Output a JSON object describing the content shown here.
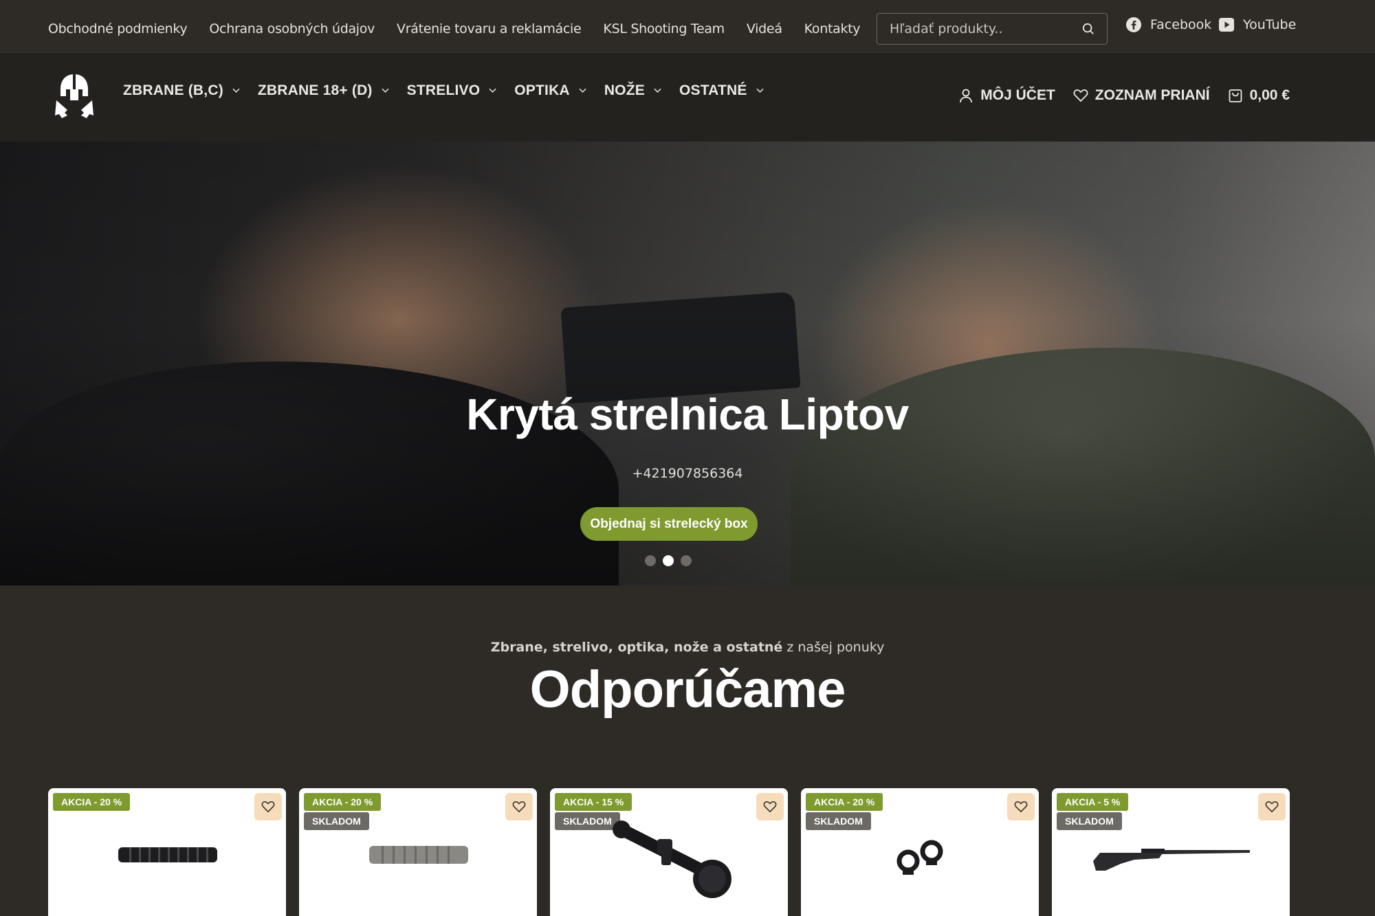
{
  "topbar": {
    "links": [
      "Obchodné podmienky",
      "Ochrana osobných údajov",
      "Vrátenie tovaru a reklamácie",
      "KSL Shooting Team",
      "Videá",
      "Kontakty"
    ],
    "search_placeholder": "Hľadať produkty..",
    "facebook": "Facebook",
    "youtube": "YouTube"
  },
  "nav": {
    "items": [
      "ZBRANE (B,C)",
      "ZBRANE 18+ (D)",
      "STRELIVO",
      "OPTIKA",
      "NOŽE",
      "OSTATNÉ"
    ],
    "account": "MÔJ ÚČET",
    "wishlist": "ZOZNAM PRIANÍ",
    "cart": "0,00 €"
  },
  "hero": {
    "title": "Krytá strelnica Liptov",
    "phone": "+421907856364",
    "cta": "Objednaj si strelecký box",
    "slides": 3,
    "active_slide": 2
  },
  "section": {
    "subtitle_bold": "Zbrane, strelivo, optika, nože a ostatné",
    "subtitle_rest": " z našej ponuky",
    "title": "Odporúčame"
  },
  "products": [
    {
      "sale": "AKCIA - 20 %",
      "stock": "",
      "icon": "suppressor-black"
    },
    {
      "sale": "AKCIA - 20 %",
      "stock": "SKLADOM",
      "icon": "suppressor-grey"
    },
    {
      "sale": "AKCIA - 15 %",
      "stock": "SKLADOM",
      "icon": "rifle-scope"
    },
    {
      "sale": "AKCIA - 20 %",
      "stock": "SKLADOM",
      "icon": "scope-rings"
    },
    {
      "sale": "AKCIA - 5 %",
      "stock": "SKLADOM",
      "icon": "rifle"
    }
  ],
  "colors": {
    "accent": "#7f9a2e",
    "background": "#2e2b27",
    "nav": "#24221f",
    "wish_bg": "#f7dcbc"
  }
}
